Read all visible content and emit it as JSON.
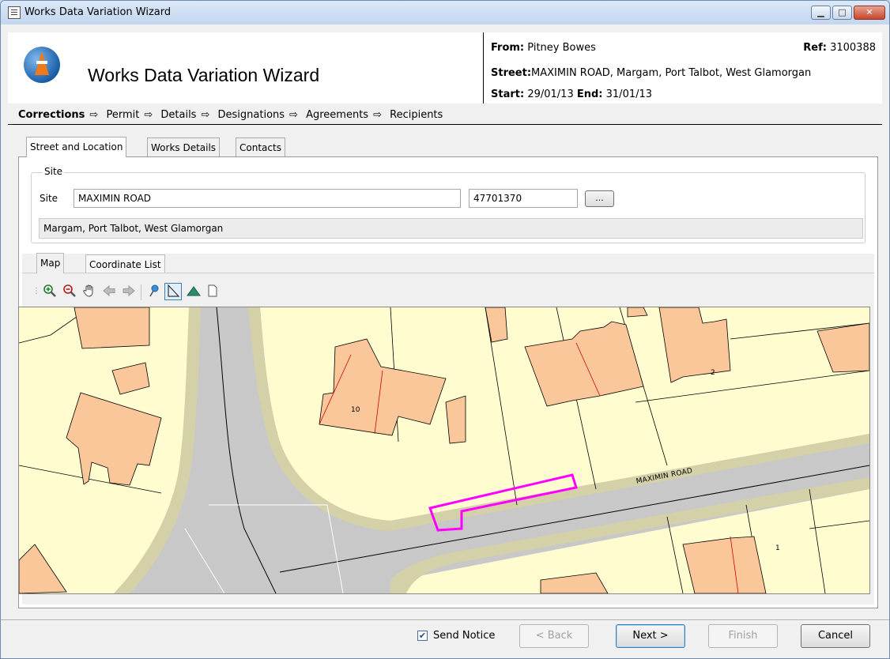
{
  "window": {
    "title": "Works Data Variation Wizard"
  },
  "header": {
    "title": "Works Data Variation Wizard",
    "from_label": "From:",
    "from_value": "Pitney Bowes",
    "ref_label": "Ref:",
    "ref_value": "3100388",
    "street_label": "Street:",
    "street_value": "MAXIMIN ROAD, Margam, Port Talbot, West Glamorgan",
    "start_label": "Start:",
    "start_value": "29/01/13",
    "end_label": "End:",
    "end_value": "31/01/13"
  },
  "steps": [
    "Corrections",
    "Permit",
    "Details",
    "Designations",
    "Agreements",
    "Recipients"
  ],
  "step_arrow": "⇨",
  "tabs": [
    "Street and Location",
    "Works Details",
    "Contacts"
  ],
  "site": {
    "legend": "Site",
    "label": "Site",
    "name": "MAXIMIN ROAD",
    "usrn": "47701370",
    "browse": "...",
    "locality": "Margam, Port Talbot, West Glamorgan"
  },
  "subtabs": [
    "Map",
    "Coordinate List"
  ],
  "map": {
    "road_label": "MAXIMIN ROAD",
    "house_numbers": [
      "10",
      "2",
      "1"
    ],
    "highlight_color": "#ff00ff"
  },
  "toolbar_icons": [
    "zoom-in-icon",
    "zoom-out-icon",
    "pan-hand-icon",
    "back-arrow-icon",
    "forward-arrow-icon",
    "pushpin-icon",
    "polyline-icon",
    "polygon-icon",
    "blank-page-icon"
  ],
  "footer": {
    "send_notice": "Send Notice",
    "send_notice_checked": true,
    "back": "< Back",
    "next": "Next >",
    "finish": "Finish",
    "cancel": "Cancel"
  }
}
